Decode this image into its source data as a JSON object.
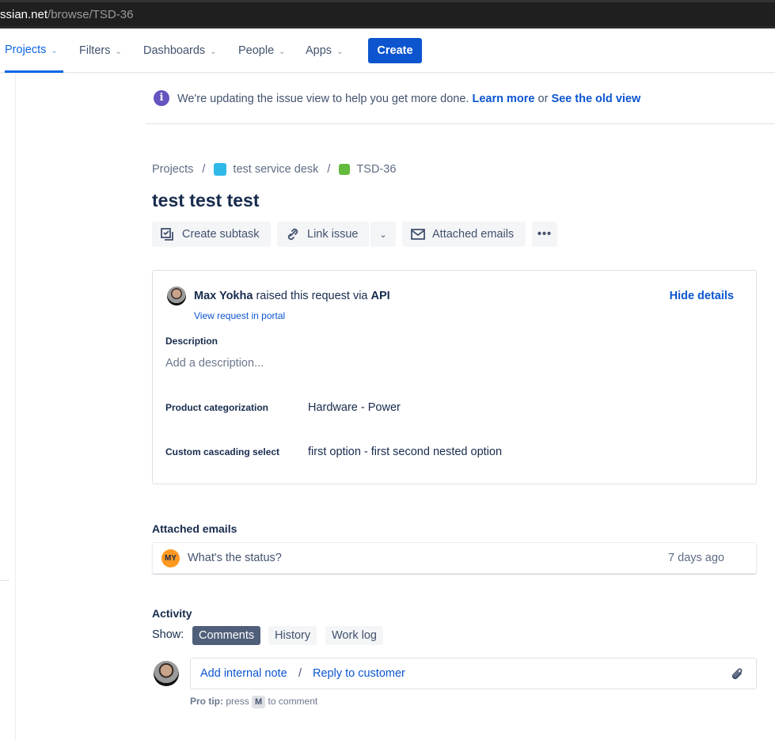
{
  "browser": {
    "url_host": "ssian.net",
    "url_path": "/browse/TSD-36"
  },
  "nav": {
    "items": [
      {
        "label": "Projects",
        "active": true
      },
      {
        "label": "Filters"
      },
      {
        "label": "Dashboards"
      },
      {
        "label": "People"
      },
      {
        "label": "Apps"
      }
    ],
    "create_label": "Create"
  },
  "banner": {
    "text": "We're updating the issue view to help you get more done.",
    "learn_more": "Learn more",
    "or": "or",
    "old_view": "See the old view"
  },
  "breadcrumb": {
    "projects": "Projects",
    "project": "test service desk",
    "issue": "TSD-36"
  },
  "issue": {
    "title": "test test test"
  },
  "toolbar": {
    "create_subtask": "Create subtask",
    "link_issue": "Link issue",
    "attached_emails": "Attached emails"
  },
  "request": {
    "reporter": "Max Yokha",
    "raised_text": "raised this request via",
    "channel": "API",
    "view_portal": "View request in portal",
    "hide_details": "Hide details"
  },
  "fields": {
    "description_label": "Description",
    "description_placeholder": "Add a description...",
    "product_label": "Product categorization",
    "product_value": "Hardware - Power",
    "cascade_label": "Custom cascading select",
    "cascade_value": "first option - first second nested option"
  },
  "emails": {
    "heading": "Attached emails",
    "items": [
      {
        "initials": "MY",
        "subject": "What's the status?",
        "time": "7 days ago"
      }
    ]
  },
  "activity": {
    "heading": "Activity",
    "show_label": "Show:",
    "tabs": [
      {
        "label": "Comments",
        "active": true
      },
      {
        "label": "History"
      },
      {
        "label": "Work log"
      }
    ],
    "add_note": "Add internal note",
    "slash": "/",
    "reply": "Reply to customer",
    "protip_label": "Pro tip:",
    "protip_press": "press",
    "protip_key": "M",
    "protip_rest": "to comment"
  }
}
